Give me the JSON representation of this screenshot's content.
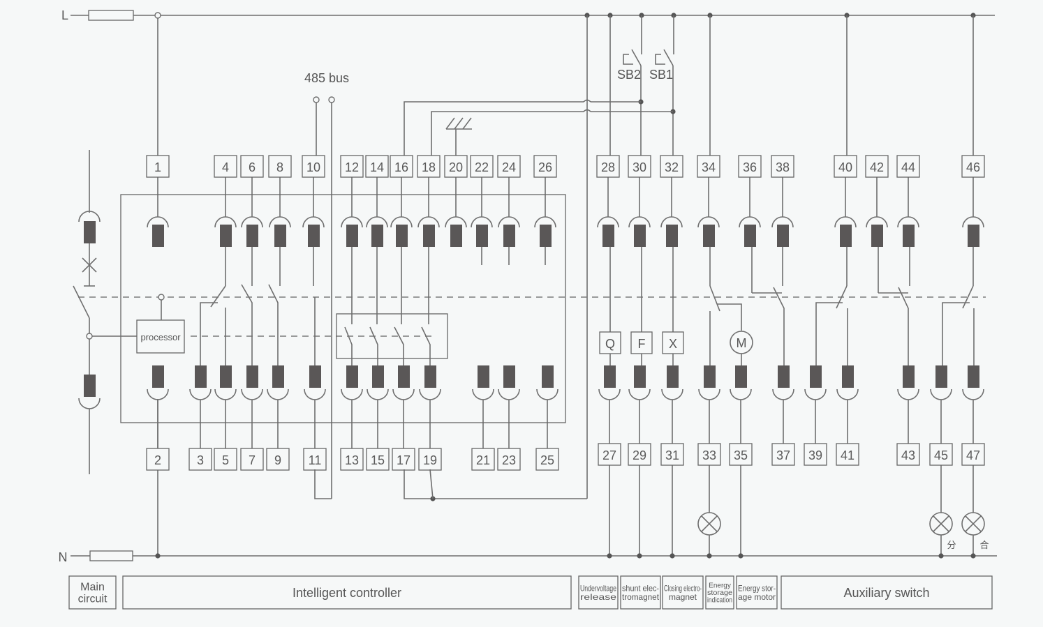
{
  "diagram": {
    "rails": {
      "line": "L",
      "neutral": "N"
    },
    "bus_label": "485 bus",
    "processor_label": "processor",
    "push_buttons": [
      "SB2",
      "SB1"
    ],
    "coil_labels": {
      "undervoltage": "Q",
      "shunt": "F",
      "closing": "X",
      "motor": "M"
    },
    "lamp_labels": {
      "open": "分",
      "close": "合"
    },
    "top_terminals": [
      "1",
      "4",
      "6",
      "8",
      "10",
      "12",
      "14",
      "16",
      "18",
      "20",
      "22",
      "24",
      "26",
      "28",
      "30",
      "32",
      "34",
      "36",
      "38",
      "40",
      "42",
      "44",
      "46"
    ],
    "bottom_terminals": [
      "2",
      "3",
      "5",
      "7",
      "9",
      "11",
      "13",
      "15",
      "17",
      "19",
      "21",
      "23",
      "25",
      "27",
      "29",
      "31",
      "33",
      "35",
      "37",
      "39",
      "41",
      "43",
      "45",
      "47"
    ],
    "sections": [
      {
        "id": "main",
        "lines": [
          "Main",
          "circuit"
        ]
      },
      {
        "id": "controller",
        "lines": [
          "Intelligent controller"
        ]
      },
      {
        "id": "undervoltage",
        "lines": [
          "Undervoltage",
          "release"
        ]
      },
      {
        "id": "shunt",
        "lines": [
          "shunt elec-",
          "tromagnet"
        ]
      },
      {
        "id": "closing",
        "lines": [
          "Closing electro-",
          "magnet"
        ]
      },
      {
        "id": "storage-ind",
        "lines": [
          "Energy",
          "storage",
          "indication"
        ]
      },
      {
        "id": "storage-motor",
        "lines": [
          "Energy stor-",
          "age  motor"
        ]
      },
      {
        "id": "aux",
        "lines": [
          "Auxiliary switch"
        ]
      }
    ]
  }
}
